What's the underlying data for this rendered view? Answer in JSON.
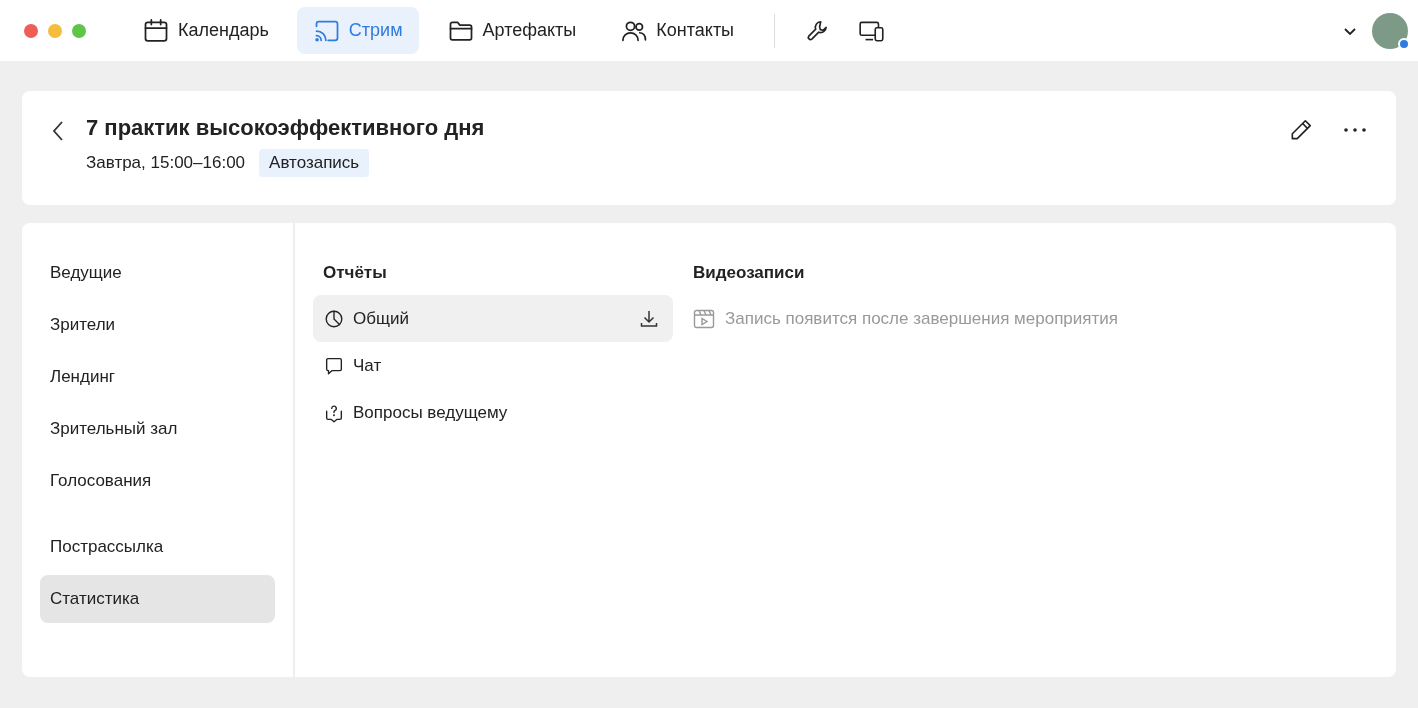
{
  "nav": [
    {
      "label": "Календарь",
      "kind": "calendar",
      "selected": false
    },
    {
      "label": "Стрим",
      "kind": "stream",
      "selected": true
    },
    {
      "label": "Артефакты",
      "kind": "artifacts",
      "selected": false
    },
    {
      "label": "Контакты",
      "kind": "contacts",
      "selected": false
    }
  ],
  "event": {
    "title": "7 практик высокоэффективного дня",
    "time": "Завтра, 15:00–16:00",
    "badge": "Автозапись"
  },
  "sidebar": {
    "groups": [
      [
        {
          "label": "Ведущие",
          "selected": false
        },
        {
          "label": "Зрители",
          "selected": false
        },
        {
          "label": "Лендинг",
          "selected": false
        },
        {
          "label": "Зрительный зал",
          "selected": false
        },
        {
          "label": "Голосования",
          "selected": false
        }
      ],
      [
        {
          "label": "Пострассылка",
          "selected": false
        },
        {
          "label": "Статистика",
          "selected": true
        }
      ]
    ]
  },
  "reports": {
    "heading": "Отчёты",
    "items": [
      {
        "label": "Общий",
        "kind": "summary",
        "selected": true
      },
      {
        "label": "Чат",
        "kind": "chat",
        "selected": false
      },
      {
        "label": "Вопросы ведущему",
        "kind": "questions",
        "selected": false
      }
    ]
  },
  "videos": {
    "heading": "Видеозаписи",
    "empty": "Запись появится после завершения мероприятия"
  }
}
